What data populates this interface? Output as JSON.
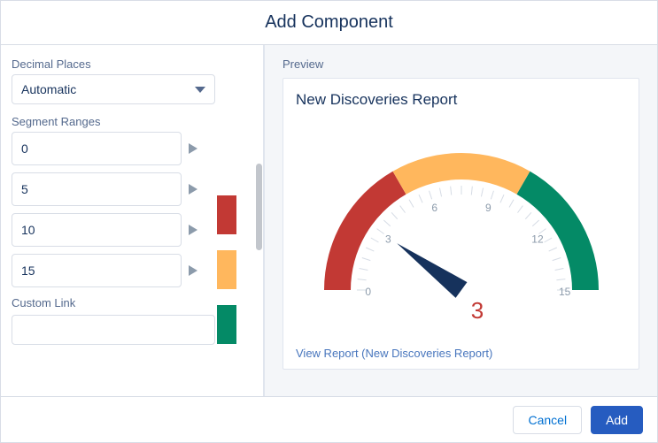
{
  "header": {
    "title": "Add Component"
  },
  "left": {
    "decimal_label": "Decimal Places",
    "decimal_value": "Automatic",
    "segment_label": "Segment Ranges",
    "segments": [
      "0",
      "5",
      "10",
      "15"
    ],
    "custom_link_label": "Custom Link",
    "colors": {
      "red": "#c23934",
      "yellow": "#ffb75d",
      "green": "#048a66"
    }
  },
  "preview": {
    "label": "Preview",
    "title": "New Discoveries Report",
    "value_display": "3",
    "view_link": "View Report (New Discoveries Report)"
  },
  "footer": {
    "cancel": "Cancel",
    "add": "Add"
  },
  "chart_data": {
    "type": "gauge",
    "min": 0,
    "max": 15,
    "value": 3,
    "ticks": [
      0,
      3,
      6,
      9,
      12,
      15
    ],
    "segments": [
      {
        "from": 0,
        "to": 5,
        "color": "#c23934"
      },
      {
        "from": 5,
        "to": 10,
        "color": "#ffb75d"
      },
      {
        "from": 10,
        "to": 15,
        "color": "#048a66"
      }
    ],
    "title": "New Discoveries Report"
  }
}
